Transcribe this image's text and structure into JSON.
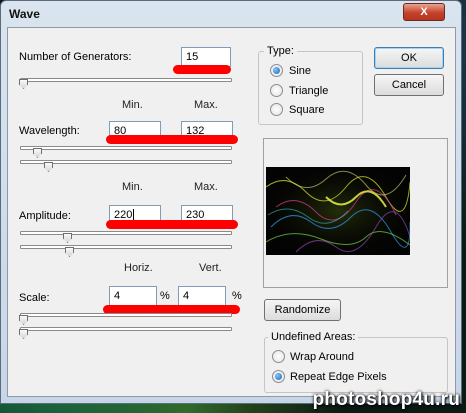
{
  "window": {
    "title": "Wave",
    "close_label": "X"
  },
  "generators": {
    "label": "Number of Generators:",
    "value": "15",
    "slider": 0.0
  },
  "headers_min_max": {
    "min": "Min.",
    "max": "Max."
  },
  "wavelength": {
    "label": "Wavelength:",
    "min": "80",
    "max": "132",
    "slider_min": 0.07,
    "slider_max": 0.12
  },
  "amplitude": {
    "label": "Amplitude:",
    "min": "220",
    "max": "230",
    "slider_min": 0.22,
    "slider_max": 0.23
  },
  "headers_horiz_vert": {
    "horiz": "Horiz.",
    "vert": "Vert."
  },
  "scale": {
    "label": "Scale:",
    "horiz": "4",
    "vert": "4",
    "unit": "%",
    "slider_horiz": 0.0,
    "slider_vert": 0.0
  },
  "type": {
    "title": "Type:",
    "options": [
      {
        "label": "Sine",
        "checked": true
      },
      {
        "label": "Triangle",
        "checked": false
      },
      {
        "label": "Square",
        "checked": false
      }
    ]
  },
  "buttons": {
    "ok": "OK",
    "cancel": "Cancel",
    "randomize": "Randomize"
  },
  "undefined_areas": {
    "title": "Undefined Areas:",
    "options": [
      {
        "label": "Wrap Around",
        "checked": false
      },
      {
        "label": "Repeat Edge Pixels",
        "checked": true
      }
    ]
  },
  "watermark": "photoshop4u.ru",
  "colors": {
    "annotation": "#ff0000",
    "accent": "#1a62b5"
  }
}
